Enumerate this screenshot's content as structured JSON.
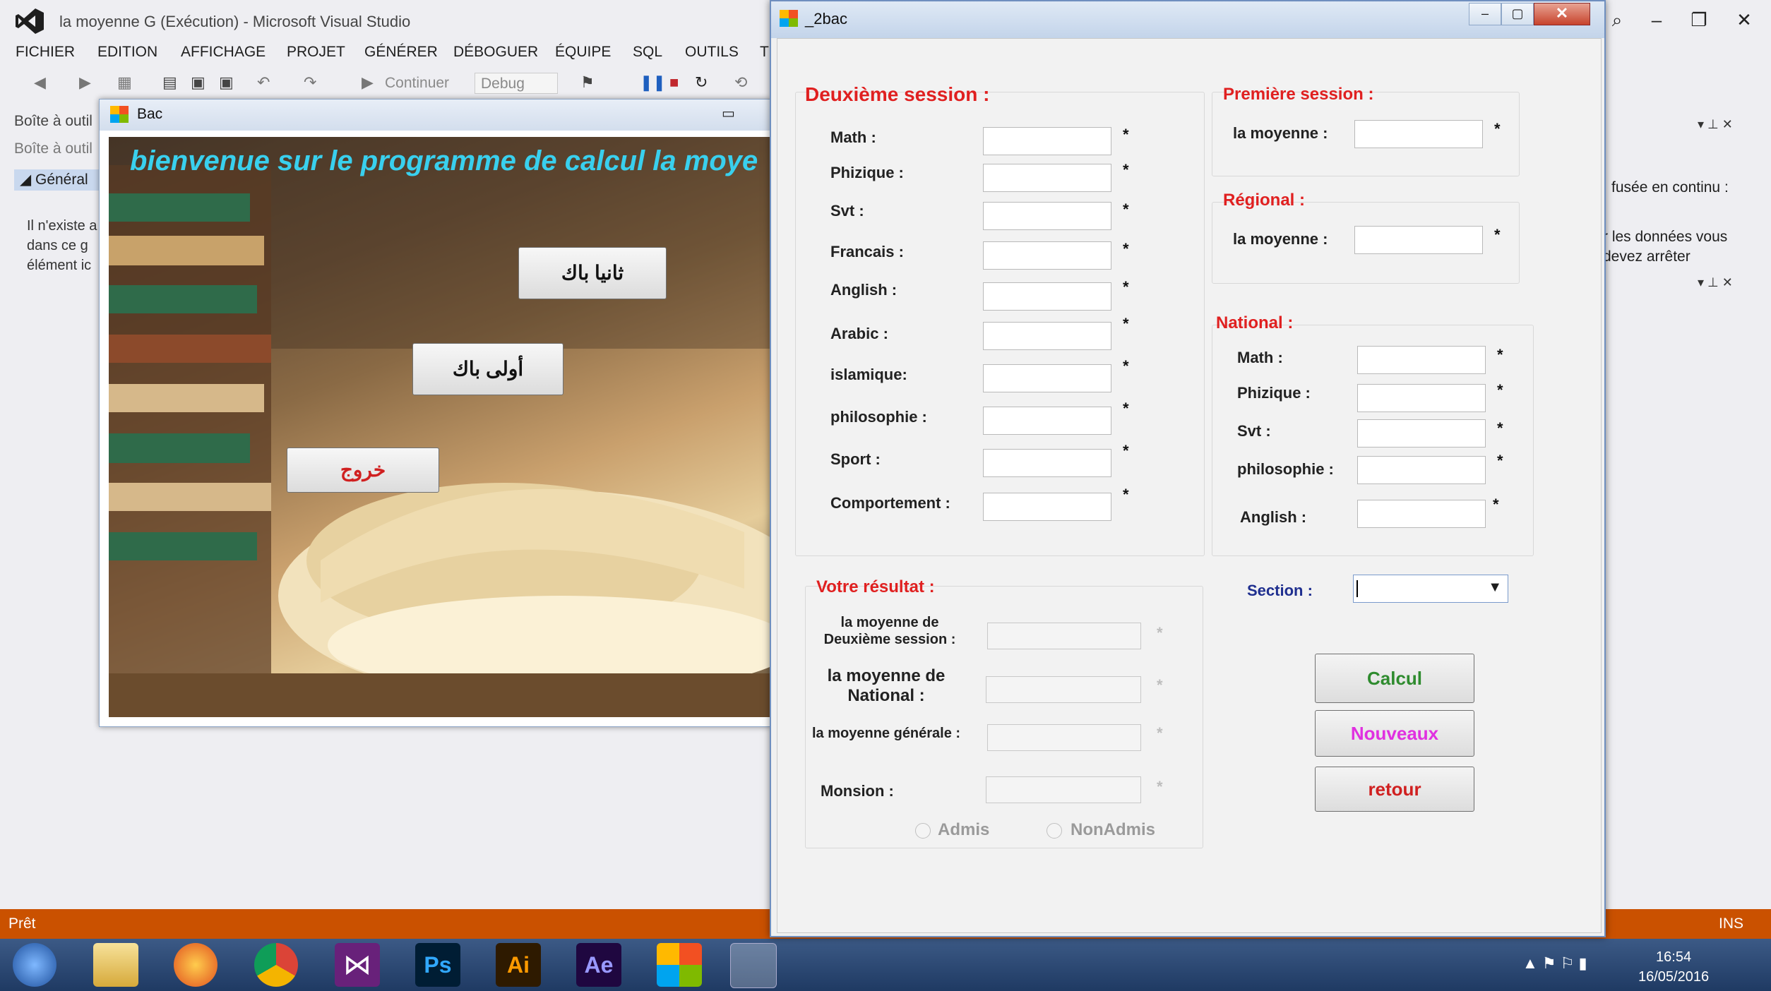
{
  "vs": {
    "title": "la moyenne G (Exécution) - Microsoft Visual Studio",
    "menu": [
      "FICHIER",
      "EDITION",
      "AFFICHAGE",
      "PROJET",
      "GÉNÉRER",
      "DÉBOGUER",
      "ÉQUIPE",
      "SQL",
      "OUTILS",
      "T"
    ],
    "toolbar": {
      "continue": "Continuer",
      "config": "Debug"
    },
    "toolbox": {
      "title": "Boîte à outil",
      "search": "Boîte à outil",
      "group": "Général",
      "empty": "Il n'existe a dans ce g élément ic"
    },
    "right_panel": {
      "stream": "fusée en continu :",
      "msg": "r les données vous devez arrêter"
    },
    "status": {
      "left": "Prêt",
      "right": "INS"
    }
  },
  "bac_window": {
    "title": "Bac",
    "welcome": "bienvenue sur  le programme de calcul la moye",
    "btn_2bac": "ثانيا باك",
    "btn_1bac": "أولى باك",
    "btn_exit": "خروج"
  },
  "bac2": {
    "title": "_2bac",
    "second_session": {
      "title": "Deuxième session :",
      "subjects": [
        "Math :",
        "Phizique :",
        "Svt :",
        "Francais :",
        "Anglish :",
        "Arabic :",
        "islamique:",
        "philosophie :",
        "Sport :",
        "Comportement :"
      ]
    },
    "first_session": {
      "title": "Première session :",
      "label": "la moyenne  :"
    },
    "regional": {
      "title": "Régional :",
      "label": "la moyenne  :"
    },
    "national": {
      "title": "National :",
      "subjects": [
        "Math :",
        "Phizique :",
        "Svt :",
        "philosophie :",
        "Anglish :"
      ]
    },
    "result": {
      "title": "Votre résultat :",
      "moy_second_1": "la moyenne de",
      "moy_second_2": "Deuxième session :",
      "moy_nat_1": "la moyenne de",
      "moy_nat_2": "National :",
      "moy_gen": "la moyenne générale :",
      "mention": "Monsion :",
      "admis": "Admis",
      "nonadmis": "NonAdmis"
    },
    "section_label": "Section :",
    "section_value": "",
    "buttons": {
      "calcul": "Calcul",
      "nouveaux": "Nouveaux",
      "retour": "retour"
    },
    "star": "*"
  },
  "taskbar": {
    "time": "16:54",
    "date": "16/05/2016"
  },
  "colors": {
    "status_bar": "#ca5100",
    "section_title": "#e02020",
    "calcul": "#2e8b2e",
    "nouveaux": "#e030e0",
    "retour": "#d02020",
    "welcome": "#39d0ee"
  }
}
